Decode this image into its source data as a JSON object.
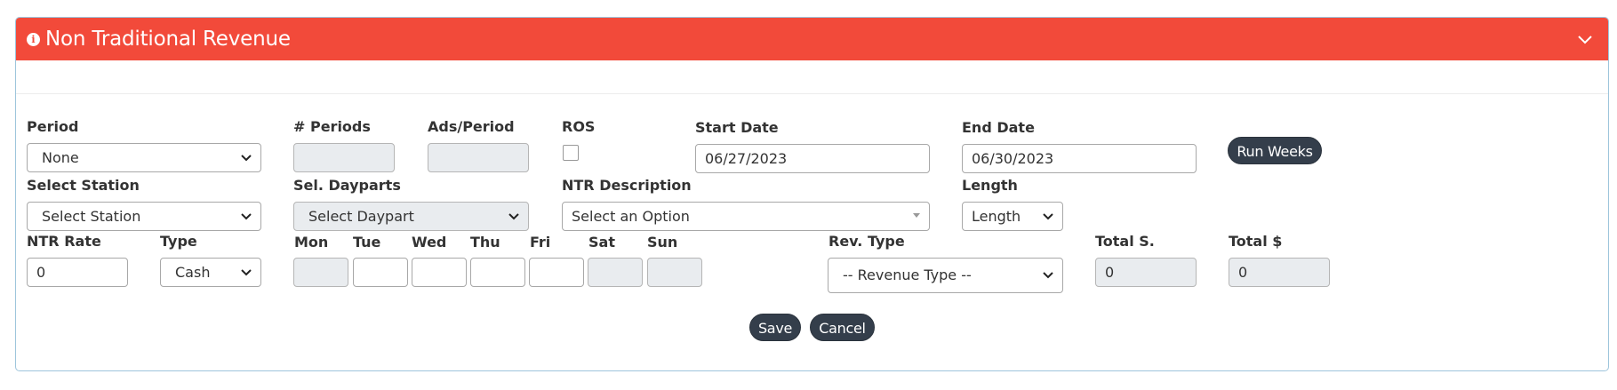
{
  "header": {
    "title": "Non Traditional Revenue",
    "accent": "#f24a3a",
    "info_icon": "info-circle-icon",
    "collapse_icon": "chevron-down-icon"
  },
  "row1": {
    "period_label": "Period",
    "period_value": "None",
    "num_periods_label": "# Periods",
    "num_periods_value": "",
    "ads_period_label": "Ads/Period",
    "ads_period_value": "",
    "ros_label": "ROS",
    "ros_checked": false,
    "start_date_label": "Start Date",
    "start_date_value": "06/27/2023",
    "end_date_label": "End Date",
    "end_date_value": "06/30/2023",
    "run_weeks_label": "Run Weeks"
  },
  "row2": {
    "station_label": "Select Station",
    "station_value": "Select Station",
    "dayparts_label": "Sel. Dayparts",
    "dayparts_value": "Select Daypart",
    "ntr_desc_label": "NTR Description",
    "ntr_desc_value": "Select an Option",
    "length_label": "Length",
    "length_value": "Length"
  },
  "row3": {
    "ntr_rate_label": "NTR Rate",
    "ntr_rate_value": "0",
    "type_label": "Type",
    "type_value": "Cash",
    "days": [
      {
        "label": "Mon",
        "value": "",
        "disabled": true
      },
      {
        "label": "Tue",
        "value": "",
        "disabled": false
      },
      {
        "label": "Wed",
        "value": "",
        "disabled": false
      },
      {
        "label": "Thu",
        "value": "",
        "disabled": false
      },
      {
        "label": "Fri",
        "value": "",
        "disabled": false
      },
      {
        "label": "Sat",
        "value": "",
        "disabled": true
      },
      {
        "label": "Sun",
        "value": "",
        "disabled": true
      }
    ],
    "rev_type_label": "Rev. Type",
    "rev_type_value": "-- Revenue Type --",
    "total_s_label": "Total S.",
    "total_s_value": "0",
    "total_dollar_label": "Total $",
    "total_dollar_value": "0"
  },
  "actions": {
    "save_label": "Save",
    "cancel_label": "Cancel",
    "button_color": "#343e4b"
  }
}
